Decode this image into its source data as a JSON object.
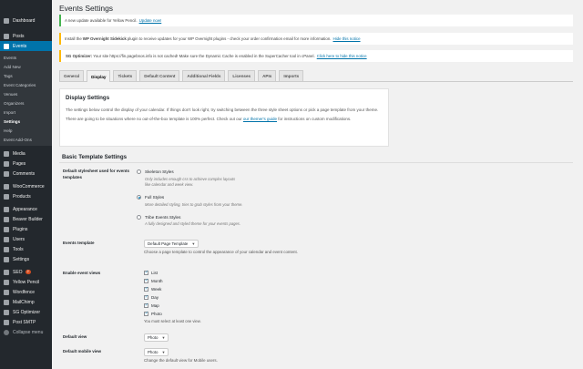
{
  "sidebar": {
    "top": [
      {
        "label": "Dashboard",
        "icon": "dashboard-icon"
      },
      {
        "label": "Posts",
        "icon": "pin-icon"
      },
      {
        "label": "Events",
        "icon": "calendar-icon",
        "active": true
      }
    ],
    "events_submenu": [
      "Events",
      "Add New",
      "Tags",
      "Event Categories",
      "Venues",
      "Organizers",
      "Import",
      "Settings",
      "Help",
      "Event Add-Ons"
    ],
    "events_submenu_current": "Settings",
    "bottom": [
      {
        "label": "Media",
        "icon": "media-icon"
      },
      {
        "label": "Pages",
        "icon": "page-icon"
      },
      {
        "label": "Comments",
        "icon": "comment-icon"
      },
      {
        "label": "WooCommerce",
        "icon": "woocommerce-icon"
      },
      {
        "label": "Products",
        "icon": "product-icon"
      },
      {
        "label": "Appearance",
        "icon": "brush-icon"
      },
      {
        "label": "Beaver Builder",
        "icon": "beaver-icon"
      },
      {
        "label": "Plugins",
        "icon": "plugin-icon"
      },
      {
        "label": "Users",
        "icon": "user-icon"
      },
      {
        "label": "Tools",
        "icon": "wrench-icon"
      },
      {
        "label": "Settings",
        "icon": "settings-icon"
      },
      {
        "label": "SEO",
        "icon": "seo-icon",
        "badge": "2"
      },
      {
        "label": "Yellow Pencil",
        "icon": "pencil-icon"
      },
      {
        "label": "Wordfence",
        "icon": "shield-icon"
      },
      {
        "label": "MailChimp",
        "icon": "mail-icon"
      },
      {
        "label": "SG Optimizer",
        "icon": "rocket-icon"
      },
      {
        "label": "Post SMTP",
        "icon": "envelope-icon"
      },
      {
        "label": "Collapse menu",
        "icon": "collapse-icon"
      }
    ]
  },
  "page": {
    "title": "Events Settings"
  },
  "notices": {
    "n1_text": "A new update available for Yellow Pencil.",
    "n1_link": "Update now!",
    "n2_pre": "Install the",
    "n2_bold": "WP Overnight Sidekick",
    "n2_text": "plugin to receive updates for your WP Overnight plugins - check your order confirmation email for more information.",
    "n2_link": "Hide this notice",
    "n3_bold": "SG Optimizer:",
    "n3_text": "Your site https://fin.pagebnos.info is not cached! Make sure the Dynamic Cache is enabled in the SuperCacher tool in cPanel.",
    "n3_link": "Click here to hide this notice"
  },
  "tabs": [
    "General",
    "Display",
    "Tickets",
    "Default Content",
    "Additional Fields",
    "Licenses",
    "APIs",
    "Imports"
  ],
  "active_tab": "Display",
  "display_box": {
    "heading": "Display Settings",
    "p1": "The settings below control the display of your calendar. If things don't look right, try switching between the three style sheet options or pick a page template from your theme.",
    "p2_pre": "There are going to be situations where no out-of-the-box template is 100% perfect. Check out our",
    "p2_link": "our themer's guide",
    "p2_post": "for instructions on custom modifications."
  },
  "basic": {
    "heading": "Basic Template Settings",
    "stylesheet_label": "Default stylesheet used for events templates",
    "stylesheet_options": [
      {
        "label": "Skeleton Styles",
        "desc": "Only includes enough css to achieve complex layouts like calendar and week view.",
        "checked": false
      },
      {
        "label": "Full Styles",
        "desc": "More detailed styling, tries to grab styles from your theme.",
        "checked": true
      },
      {
        "label": "Tribe Events Styles",
        "desc": "A fully designed and styled theme for your events pages.",
        "checked": false
      }
    ],
    "template_label": "Events template",
    "template_value": "Default Page Template",
    "template_help": "Choose a page template to control the appearance of your calendar and event content.",
    "views_label": "Enable event views",
    "views": [
      {
        "label": "List",
        "checked": true
      },
      {
        "label": "Month",
        "checked": true
      },
      {
        "label": "Week",
        "checked": true
      },
      {
        "label": "Day",
        "checked": true
      },
      {
        "label": "Map",
        "checked": true
      },
      {
        "label": "Photo",
        "checked": true
      }
    ],
    "views_help": "You must select at least one view.",
    "default_view_label": "Default view",
    "default_view_value": "Photo",
    "default_mobile_label": "Default mobile view",
    "default_mobile_value": "Photo",
    "default_mobile_help": "Change the default view for Mobile users."
  }
}
